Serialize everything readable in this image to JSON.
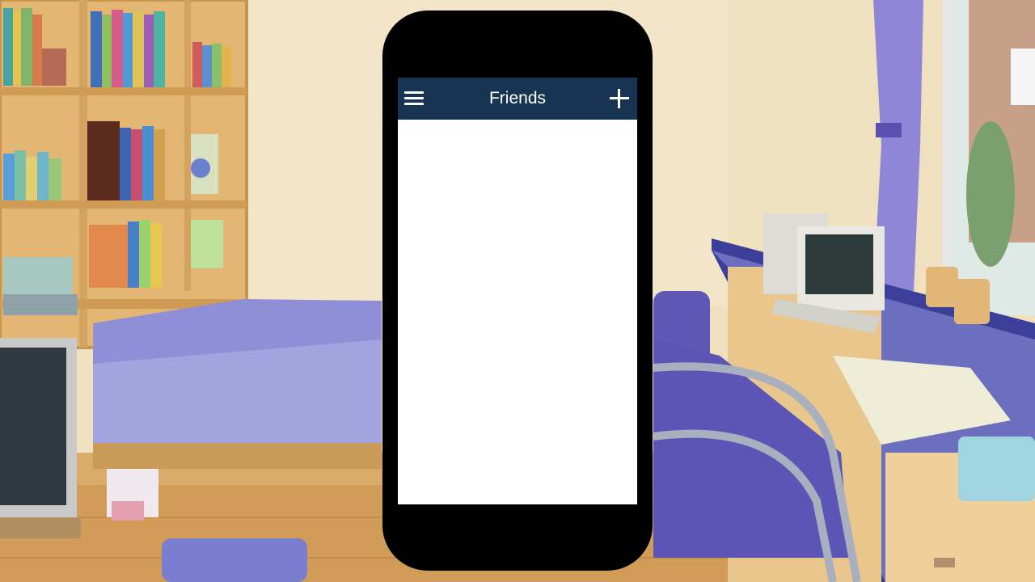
{
  "app_bar": {
    "title": "Friends",
    "menu_icon": "hamburger-menu-icon",
    "add_icon": "plus-icon",
    "background_color": "#173552",
    "text_color": "#ffffff"
  },
  "friends_list": {
    "items": []
  },
  "phone": {
    "frame_color": "#000000",
    "screen_color": "#ffffff"
  }
}
